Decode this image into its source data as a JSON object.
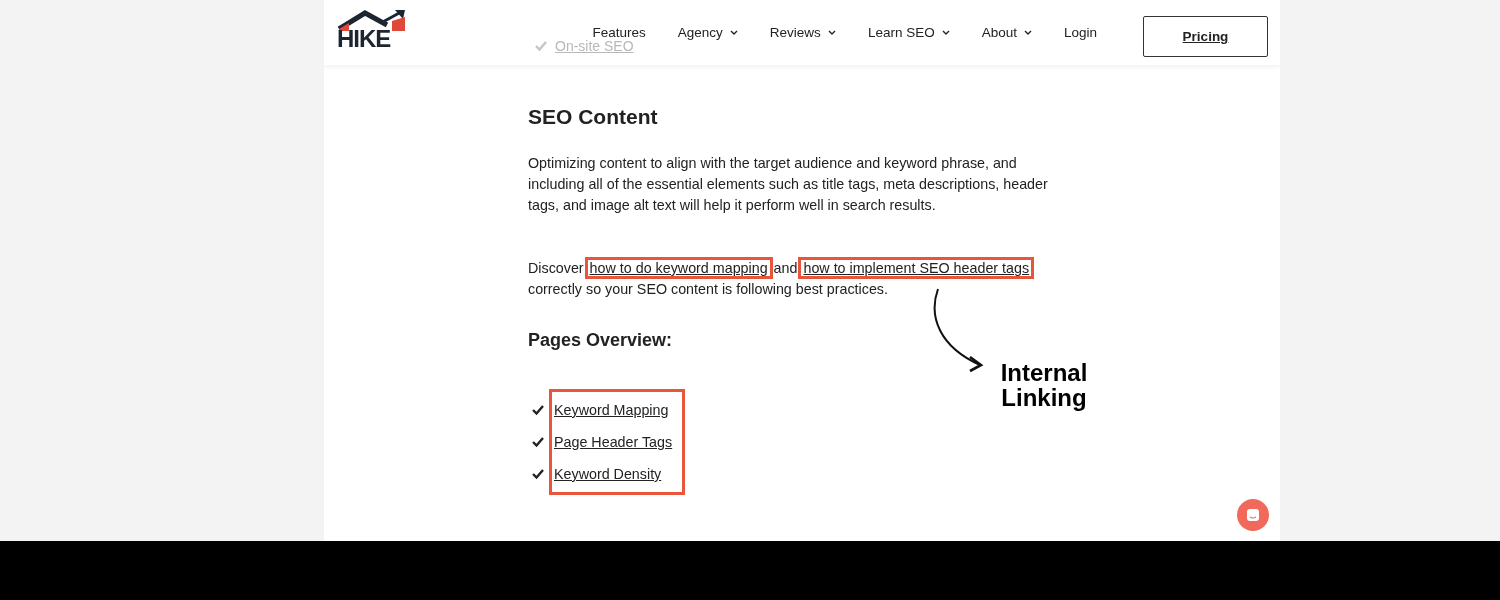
{
  "header": {
    "logo": "HIKE",
    "nav": [
      {
        "label": "Features",
        "dropdown": false
      },
      {
        "label": "Agency",
        "dropdown": true
      },
      {
        "label": "Reviews",
        "dropdown": true
      },
      {
        "label": "Learn SEO",
        "dropdown": true
      },
      {
        "label": "About",
        "dropdown": true
      },
      {
        "label": "Login",
        "dropdown": false
      }
    ],
    "cta": "Pricing"
  },
  "behind_header": {
    "item": "On-site SEO",
    "checked": true
  },
  "article": {
    "heading": "SEO Content",
    "paragraph": "Optimizing content to align with the target audience and keyword phrase, and including all of the essential elements such as title tags, meta descriptions, header tags, and image alt text will help it perform well in search results.",
    "discover": [
      {
        "kind": "text",
        "text": "Discover "
      },
      {
        "kind": "link",
        "text": "how to do keyword mapping",
        "highlighted": true
      },
      {
        "kind": "text",
        "text": " and "
      },
      {
        "kind": "link",
        "text": "how to implement SEO header tags",
        "highlighted": true
      },
      {
        "kind": "text",
        "text": " correctly so your SEO content is following best practices."
      }
    ],
    "subheading": "Pages Overview:",
    "pages_highlighted": true,
    "pages": [
      {
        "label": "Keyword Mapping",
        "checked": true
      },
      {
        "label": "Page Header Tags",
        "checked": true
      },
      {
        "label": "Keyword Density",
        "checked": true
      }
    ]
  },
  "annotation": {
    "label": "Internal Linking"
  }
}
